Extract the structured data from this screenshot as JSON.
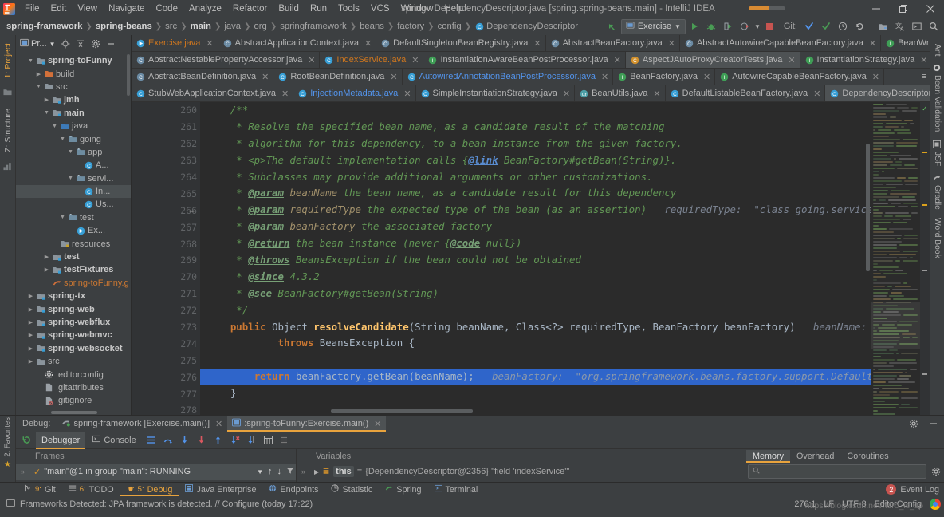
{
  "window": {
    "title": "spring - DependencyDescriptor.java [spring.spring-beans.main] - IntelliJ IDEA",
    "minimize": "—",
    "maximize": "❐",
    "close": "✕"
  },
  "menu": [
    {
      "label": "File"
    },
    {
      "label": "Edit"
    },
    {
      "label": "View"
    },
    {
      "label": "Navigate"
    },
    {
      "label": "Code"
    },
    {
      "label": "Analyze"
    },
    {
      "label": "Refactor"
    },
    {
      "label": "Build"
    },
    {
      "label": "Run"
    },
    {
      "label": "Tools"
    },
    {
      "label": "VCS"
    },
    {
      "label": "Window"
    },
    {
      "label": "Help"
    }
  ],
  "breadcrumb": [
    {
      "label": "spring-framework",
      "bold": true
    },
    {
      "label": "spring-beans",
      "bold": true
    },
    {
      "label": "src",
      "bold": false
    },
    {
      "label": "main",
      "bold": true
    },
    {
      "label": "java",
      "bold": false
    },
    {
      "label": "org",
      "bold": false
    },
    {
      "label": "springframework",
      "bold": false
    },
    {
      "label": "beans",
      "bold": false
    },
    {
      "label": "factory",
      "bold": false
    },
    {
      "label": "config",
      "bold": false
    },
    {
      "label": "DependencyDescriptor",
      "bold": false,
      "icon": "class-icon"
    }
  ],
  "toolbar": {
    "back_icon": "back-arrow-icon",
    "run_config": "Exercise",
    "run_icon": "run-icon",
    "debug_icon": "debug-icon",
    "run_coverage_icon": "run-with-coverage-icon",
    "profile_icon": "profile-icon",
    "stop_icon": "stop-icon",
    "git_label": "Git:",
    "update_icon": "update-project-icon",
    "commit_icon": "commit-icon",
    "history_icon": "history-icon",
    "rollback_icon": "rollback-icon",
    "module_icon": "project-structure-icon",
    "translate_icon": "translate-icon",
    "terminal_icon": "terminal-icon",
    "search_icon": "search-everywhere-icon"
  },
  "left_rail": {
    "project_tab": "1: Project",
    "structure_tab": "Z: Structure",
    "favorites_tab": "2: Favorites"
  },
  "project_panel": {
    "title": "Pr...",
    "locate_icon": "locate-icon",
    "collapse_icon": "collapse-all-icon",
    "settings_icon": "gear-icon",
    "hide_icon": "hide-icon",
    "tree": [
      {
        "label": "spring-toFunny",
        "indent": 1,
        "arrow": "down",
        "icon": "module-icon",
        "bold": true
      },
      {
        "label": "build",
        "indent": 2,
        "arrow": "right",
        "icon": "folder-orange-icon",
        "bold": false
      },
      {
        "label": "src",
        "indent": 2,
        "arrow": "down",
        "icon": "folder-icon",
        "bold": false
      },
      {
        "label": "jmh",
        "indent": 3,
        "arrow": "right",
        "icon": "module-icon",
        "bold": true
      },
      {
        "label": "main",
        "indent": 3,
        "arrow": "down",
        "icon": "module-icon",
        "bold": true
      },
      {
        "label": "java",
        "indent": 4,
        "arrow": "down",
        "icon": "source-root-icon",
        "bold": false
      },
      {
        "label": "going",
        "indent": 5,
        "arrow": "down",
        "icon": "package-icon",
        "bold": false
      },
      {
        "label": "app",
        "indent": 6,
        "arrow": "down",
        "icon": "package-icon",
        "bold": false
      },
      {
        "label": "A...",
        "indent": 7,
        "arrow": "none",
        "icon": "class-icon",
        "bold": false
      },
      {
        "label": "servi...",
        "indent": 6,
        "arrow": "down",
        "icon": "package-icon",
        "bold": false
      },
      {
        "label": "In...",
        "indent": 7,
        "arrow": "none",
        "icon": "class-icon",
        "bold": false,
        "selected": true
      },
      {
        "label": "Us...",
        "indent": 7,
        "arrow": "none",
        "icon": "class-icon",
        "bold": false
      },
      {
        "label": "test",
        "indent": 5,
        "arrow": "down",
        "icon": "package-icon",
        "bold": false
      },
      {
        "label": "Ex...",
        "indent": 6,
        "arrow": "none",
        "icon": "class-run-icon",
        "bold": false
      },
      {
        "label": "resources",
        "indent": 4,
        "arrow": "none",
        "icon": "resource-root-icon",
        "bold": false
      },
      {
        "label": "test",
        "indent": 3,
        "arrow": "right",
        "icon": "module-icon",
        "bold": true
      },
      {
        "label": "testFixtures",
        "indent": 3,
        "arrow": "right",
        "icon": "module-icon",
        "bold": true
      },
      {
        "label": "spring-toFunny.g",
        "indent": 3,
        "arrow": "none",
        "icon": "gradle-icon",
        "bold": false,
        "orange": true
      },
      {
        "label": "spring-tx",
        "indent": 1,
        "arrow": "right",
        "icon": "module-icon",
        "bold": true
      },
      {
        "label": "spring-web",
        "indent": 1,
        "arrow": "right",
        "icon": "module-icon",
        "bold": true
      },
      {
        "label": "spring-webflux",
        "indent": 1,
        "arrow": "right",
        "icon": "module-icon",
        "bold": true
      },
      {
        "label": "spring-webmvc",
        "indent": 1,
        "arrow": "right",
        "icon": "module-icon",
        "bold": true
      },
      {
        "label": "spring-websocket",
        "indent": 1,
        "arrow": "right",
        "icon": "module-icon",
        "bold": true
      },
      {
        "label": "src",
        "indent": 1,
        "arrow": "right",
        "icon": "folder-icon",
        "bold": false
      },
      {
        "label": ".editorconfig",
        "indent": 2,
        "arrow": "none",
        "icon": "editorconfig-icon",
        "bold": false
      },
      {
        "label": ".gitattributes",
        "indent": 2,
        "arrow": "none",
        "icon": "file-icon",
        "bold": false
      },
      {
        "label": ".gitignore",
        "indent": 2,
        "arrow": "none",
        "icon": "gitignore-icon",
        "bold": false
      }
    ]
  },
  "editor_tabs": [
    [
      {
        "label": "Exercise.java",
        "icon": "class-run-icon",
        "color": "orange"
      },
      {
        "label": "AbstractApplicationContext.java",
        "icon": "class-abstract-icon"
      },
      {
        "label": "DefaultSingletonBeanRegistry.java",
        "icon": "class-abstract-icon"
      },
      {
        "label": "AbstractBeanFactory.java",
        "icon": "class-abstract-icon"
      },
      {
        "label": "AbstractAutowireCapableBeanFactory.java",
        "icon": "class-abstract-icon"
      },
      {
        "label": "BeanWrapper.java",
        "icon": "interface-icon"
      }
    ],
    [
      {
        "label": "AbstractNestablePropertyAccessor.java",
        "icon": "class-abstract-icon"
      },
      {
        "label": "IndexService.java",
        "icon": "class-icon",
        "color": "orange"
      },
      {
        "label": "InstantiationAwareBeanPostProcessor.java",
        "icon": "interface-icon"
      },
      {
        "label": "AspectJAutoProxyCreatorTests.java",
        "icon": "class-test-icon",
        "active": true
      },
      {
        "label": "InstantiationStrategy.java",
        "icon": "interface-icon"
      }
    ],
    [
      {
        "label": "AbstractBeanDefinition.java",
        "icon": "class-abstract-icon"
      },
      {
        "label": "RootBeanDefinition.java",
        "icon": "class-icon"
      },
      {
        "label": "AutowiredAnnotationBeanPostProcessor.java",
        "icon": "class-icon",
        "color": "blue"
      },
      {
        "label": "BeanFactory.java",
        "icon": "interface-icon"
      },
      {
        "label": "AutowireCapableBeanFactory.java",
        "icon": "interface-icon"
      }
    ],
    [
      {
        "label": "StubWebApplicationContext.java",
        "icon": "class-icon"
      },
      {
        "label": "InjectionMetadata.java",
        "icon": "class-icon",
        "color": "blue"
      },
      {
        "label": "SimpleInstantiationStrategy.java",
        "icon": "class-icon"
      },
      {
        "label": "BeanUtils.java",
        "icon": "class-final-icon"
      },
      {
        "label": "DefaultListableBeanFactory.java",
        "icon": "class-icon"
      },
      {
        "label": "DependencyDescriptor.java",
        "icon": "class-icon",
        "active": true,
        "underline": true
      }
    ]
  ],
  "code": {
    "first_line": 260,
    "lines": [
      {
        "n": 260,
        "segments": [
          {
            "t": "    /**",
            "c": "cmt"
          }
        ]
      },
      {
        "n": 261,
        "segments": [
          {
            "t": "     * Resolve the specified bean name, as a candidate result of the matching",
            "c": "cmt"
          }
        ]
      },
      {
        "n": 262,
        "segments": [
          {
            "t": "     * algorithm for this dependency, to a bean instance from the given factory.",
            "c": "cmt"
          }
        ]
      },
      {
        "n": 263,
        "segments": [
          {
            "t": "     * <p>The default implementation calls {",
            "c": "cmt"
          },
          {
            "t": "@link",
            "c": "linkk"
          },
          {
            "t": " BeanFactory#getBean(String)}.",
            "c": "cmt"
          }
        ]
      },
      {
        "n": 264,
        "segments": [
          {
            "t": "     * Subclasses may provide additional arguments or other customizations.",
            "c": "cmt"
          }
        ]
      },
      {
        "n": 265,
        "segments": [
          {
            "t": "     * ",
            "c": "cmt"
          },
          {
            "t": "@param",
            "c": "tag"
          },
          {
            "t": " beanName",
            "c": "pname"
          },
          {
            "t": " the bean name, as a candidate result for this dependency",
            "c": "cmt"
          }
        ]
      },
      {
        "n": 266,
        "segments": [
          {
            "t": "     * ",
            "c": "cmt"
          },
          {
            "t": "@param",
            "c": "tag"
          },
          {
            "t": " requiredType",
            "c": "pname"
          },
          {
            "t": " the expected type of the bean (as an assertion)",
            "c": "cmt"
          },
          {
            "t": "   requiredType:  \"class going.service.IndexService\"",
            "c": "hint"
          }
        ]
      },
      {
        "n": 267,
        "segments": [
          {
            "t": "     * ",
            "c": "cmt"
          },
          {
            "t": "@param",
            "c": "tag"
          },
          {
            "t": " beanFactory",
            "c": "pname"
          },
          {
            "t": " the associated factory",
            "c": "cmt"
          }
        ]
      },
      {
        "n": 268,
        "segments": [
          {
            "t": "     * ",
            "c": "cmt"
          },
          {
            "t": "@return",
            "c": "tag"
          },
          {
            "t": " the bean instance (never {",
            "c": "cmt"
          },
          {
            "t": "@code",
            "c": "tag"
          },
          {
            "t": " null})",
            "c": "cmt"
          }
        ]
      },
      {
        "n": 269,
        "segments": [
          {
            "t": "     * ",
            "c": "cmt"
          },
          {
            "t": "@throws",
            "c": "tag"
          },
          {
            "t": " BeansException if the bean could not be obtained",
            "c": "cmt"
          }
        ]
      },
      {
        "n": 270,
        "segments": [
          {
            "t": "     * ",
            "c": "cmt"
          },
          {
            "t": "@since",
            "c": "tag"
          },
          {
            "t": " 4.3.2",
            "c": "cmt"
          }
        ]
      },
      {
        "n": 271,
        "segments": [
          {
            "t": "     * ",
            "c": "cmt"
          },
          {
            "t": "@see",
            "c": "tag"
          },
          {
            "t": " BeanFactory#getBean(String)",
            "c": "cmt"
          }
        ]
      },
      {
        "n": 272,
        "segments": [
          {
            "t": "     */",
            "c": "cmt"
          }
        ]
      },
      {
        "n": 273,
        "segments": [
          {
            "t": "    ",
            "c": "txt"
          },
          {
            "t": "public",
            "c": "kw"
          },
          {
            "t": " Object ",
            "c": "txt"
          },
          {
            "t": "resolveCandidate",
            "c": "mth"
          },
          {
            "t": "(String beanName, Class<?> requiredType, BeanFactory beanFactory)",
            "c": "txt"
          },
          {
            "t": "   beanName:  \"indexService\"   req",
            "c": "hint"
          }
        ]
      },
      {
        "n": 274,
        "segments": [
          {
            "t": "            ",
            "c": "txt"
          },
          {
            "t": "throws",
            "c": "kw"
          },
          {
            "t": " BeansException {",
            "c": "txt"
          }
        ]
      },
      {
        "n": 275,
        "segments": [
          {
            "t": "",
            "c": "txt"
          }
        ]
      },
      {
        "n": 276,
        "highlight": true,
        "segments": [
          {
            "t": "        ",
            "c": "txt"
          },
          {
            "t": "return",
            "c": "kw"
          },
          {
            "t": " beanFactory.getBean(beanName);",
            "c": "txt"
          },
          {
            "t": "   beanFactory:  \"org.springframework.beans.factory.support.DefaultListableBeanFactory",
            "c": "hint2"
          }
        ]
      },
      {
        "n": 277,
        "segments": [
          {
            "t": "    }",
            "c": "txt"
          }
        ]
      },
      {
        "n": 278,
        "segments": [
          {
            "t": "",
            "c": "txt"
          }
        ]
      }
    ],
    "breakpoint_line": 273,
    "current_line": 276
  },
  "right_rail": [
    {
      "label": "Ant",
      "icon": "ant-icon"
    },
    {
      "label": "Bean Validation",
      "icon": "bean-validation-icon"
    },
    {
      "label": "JSF",
      "icon": "jsf-icon"
    },
    {
      "label": "Gradle",
      "icon": "gradle-icon"
    },
    {
      "label": "Word Book",
      "icon": "word-book-icon"
    }
  ],
  "debug": {
    "label": "Debug:",
    "tabs": [
      {
        "label": "spring-framework [Exercise.main()]",
        "icon": "gradle-run-icon",
        "active": false
      },
      {
        "label": ":spring-toFunny:Exercise.main()",
        "icon": "gradle-task-icon",
        "active": true
      }
    ],
    "rerun_icon": "rerun-icon",
    "subtabs": [
      {
        "label": "Debugger",
        "icon": "debugger-icon",
        "active": true
      },
      {
        "label": "Console",
        "icon": "console-icon",
        "active": false
      }
    ],
    "toolbar_icons": [
      "show-execution-point-icon",
      "step-over-icon",
      "step-into-icon",
      "force-step-into-icon",
      "step-out-icon",
      "drop-frame-icon",
      "run-to-cursor-icon",
      "evaluate-expression-icon",
      "mute-breakpoints-icon"
    ],
    "frames_header": "Frames",
    "frame": "\"main\"@1 in group \"main\": RUNNING",
    "frame_icons": [
      "threads-icon",
      "up-icon",
      "down-icon",
      "filter-icon"
    ],
    "variables_header": "Variables",
    "variable": {
      "name": "this",
      "eq": "=",
      "value": "{DependencyDescriptor@2356} \"field 'indexService'\""
    },
    "memory_tabs": [
      {
        "label": "Memory",
        "active": true
      },
      {
        "label": "Overhead",
        "active": false
      },
      {
        "label": "Coroutines",
        "active": false
      }
    ],
    "search_placeholder": "",
    "search_icon": "search-icon",
    "settings_icon": "gear-icon"
  },
  "tool_windows": [
    {
      "num": "9:",
      "label": "Git",
      "icon": "git-icon",
      "active": false
    },
    {
      "num": "6:",
      "label": "TODO",
      "icon": "todo-icon",
      "active": false
    },
    {
      "num": "5:",
      "label": "Debug",
      "icon": "debug-icon",
      "active": true
    },
    {
      "num": "",
      "label": "Java Enterprise",
      "icon": "java-enterprise-icon",
      "active": false
    },
    {
      "num": "",
      "label": "Endpoints",
      "icon": "endpoints-icon",
      "active": false
    },
    {
      "num": "",
      "label": "Statistic",
      "icon": "statistic-icon",
      "active": false
    },
    {
      "num": "",
      "label": "Spring",
      "icon": "spring-icon",
      "active": false
    },
    {
      "num": "",
      "label": "Terminal",
      "icon": "terminal-icon",
      "active": false
    }
  ],
  "event_log": {
    "label": "Event Log",
    "count": "2"
  },
  "status": {
    "message": "Frameworks Detected: JPA framework is detected. // Configure (today 17:22)",
    "message_icon": "notification-icon",
    "position": "276:1",
    "line_sep": "LF",
    "encoding": "UTF-8",
    "editor_config": "EditorConfig",
    "watermark": "https://blog.csdn.net/hero_is_sp",
    "browser_icon": "chrome-icon"
  }
}
